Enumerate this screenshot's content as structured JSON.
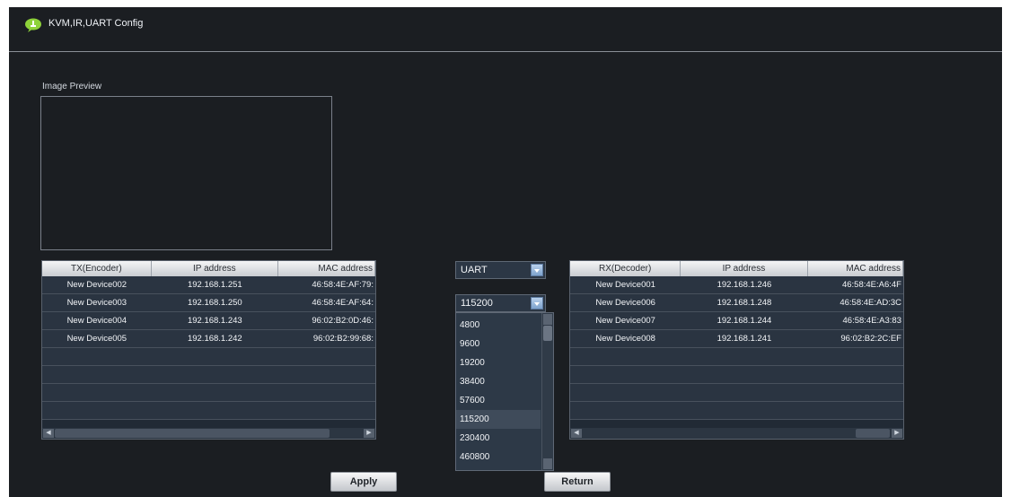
{
  "window": {
    "title": "KVM,IR,UART Config",
    "icon": "green-speech-bubble-icon"
  },
  "preview": {
    "label": "Image Preview"
  },
  "tx_table": {
    "columns": [
      "TX(Encoder)",
      "IP address",
      "MAC address"
    ],
    "rows": [
      [
        "New Device002",
        "192.168.1.251",
        "46:58:4E:AF:79:"
      ],
      [
        "New Device003",
        "192.168.1.250",
        "46:58:4E:AF:64:"
      ],
      [
        "New Device004",
        "192.168.1.243",
        "96:02:B2:0D:46:"
      ],
      [
        "New Device005",
        "192.168.1.242",
        "96:02:B2:99:68:"
      ]
    ]
  },
  "rx_table": {
    "columns": [
      "RX(Decoder)",
      "IP address",
      "MAC address"
    ],
    "rows": [
      [
        "New Device001",
        "192.168.1.246",
        "46:58:4E:A6:4F"
      ],
      [
        "New Device006",
        "192.168.1.248",
        "46:58:4E:AD:3C"
      ],
      [
        "New Device007",
        "192.168.1.244",
        "46:58:4E:A3:83"
      ],
      [
        "New Device008",
        "192.168.1.241",
        "96:02:B2:2C:EF"
      ]
    ]
  },
  "mode_select": {
    "value": "UART"
  },
  "baud_select": {
    "value": "115200",
    "options": [
      "4800",
      "9600",
      "19200",
      "38400",
      "57600",
      "115200",
      "230400",
      "460800"
    ],
    "selected_index": 5
  },
  "buttons": {
    "apply": "Apply",
    "return": "Return"
  },
  "colors": {
    "background": "#1b1e22",
    "panel": "#212a35",
    "accent": "#8ed23a"
  }
}
